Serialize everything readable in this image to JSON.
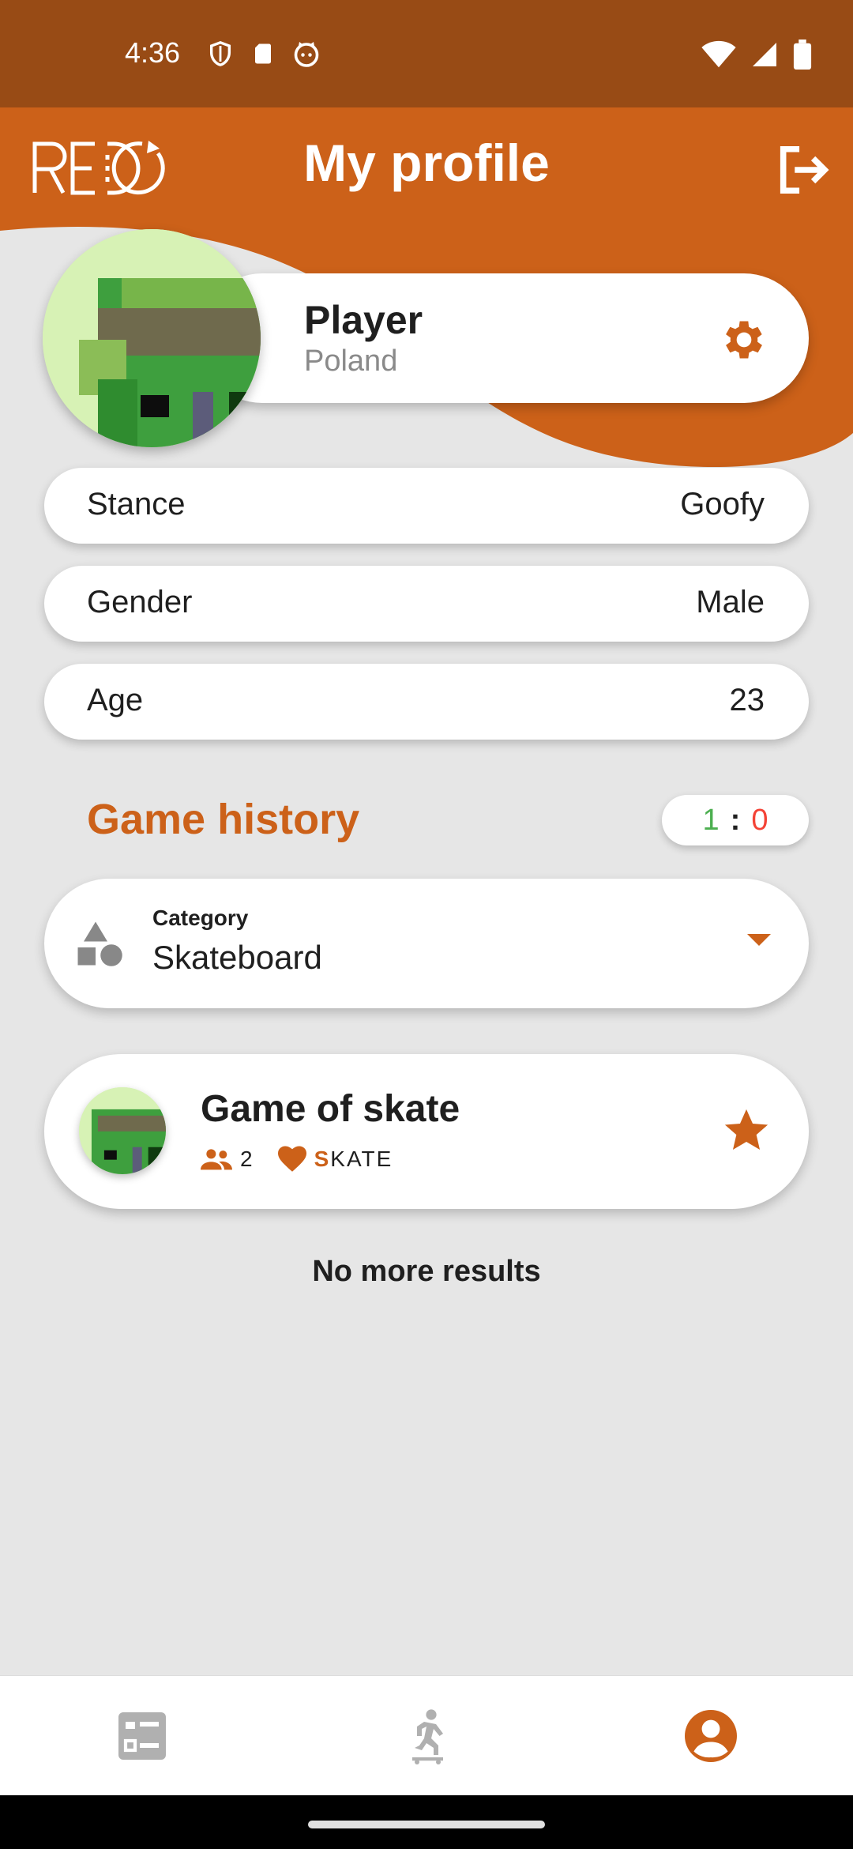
{
  "status_bar": {
    "time": "4:36"
  },
  "header": {
    "title": "My profile",
    "logo_text": "REDO",
    "colors": {
      "primary": "#cc6119",
      "status": "#984b15"
    }
  },
  "profile": {
    "name": "Player",
    "country": "Poland"
  },
  "info": [
    {
      "label": "Stance",
      "value": "Goofy"
    },
    {
      "label": "Gender",
      "value": "Male"
    },
    {
      "label": "Age",
      "value": "23"
    }
  ],
  "history": {
    "title": "Game history",
    "score": {
      "wins": "1",
      "separator": ":",
      "losses": "0"
    }
  },
  "category": {
    "label": "Category",
    "value": "Skateboard"
  },
  "games": [
    {
      "title": "Game of skate",
      "players": "2",
      "word_done": "S",
      "word_rest": "KATE"
    }
  ],
  "footer_text": "No more results",
  "bottom_nav": [
    {
      "name": "games-list",
      "icon": "list-icon"
    },
    {
      "name": "play",
      "icon": "skater-icon"
    },
    {
      "name": "profile",
      "icon": "account-icon",
      "active": true
    }
  ]
}
